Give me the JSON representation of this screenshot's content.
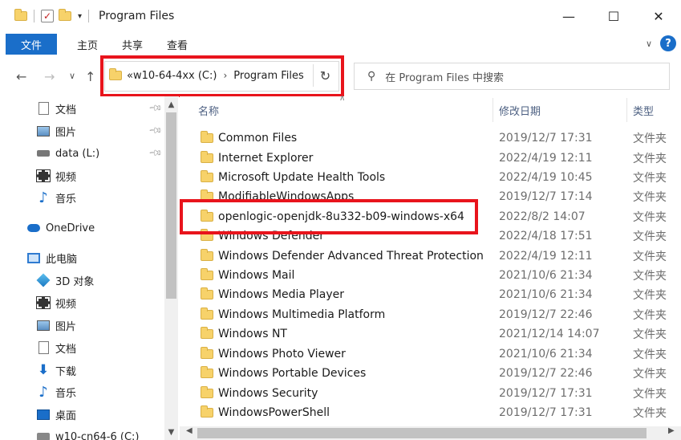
{
  "window": {
    "title": "Program Files",
    "controls": {
      "minimize": "—",
      "maximize": "☐",
      "close": "✕"
    }
  },
  "ribbon": {
    "file_tab": "文件",
    "tabs": [
      "主页",
      "共享",
      "查看"
    ],
    "help": "?"
  },
  "nav": {
    "back": "←",
    "forward": "→",
    "recent": "∨",
    "up": "↑",
    "address": {
      "prefix": "«",
      "segment1": "w10-64-4xx (C:)",
      "separator": "›",
      "segment2": "Program Files",
      "refresh": "↻"
    },
    "search_placeholder": "在 Program Files 中搜索"
  },
  "sidebar": {
    "items": [
      {
        "label": "文档",
        "icon": "document-icon",
        "pinned": true
      },
      {
        "label": "图片",
        "icon": "pictures-icon",
        "pinned": true
      },
      {
        "label": "data (L:)",
        "icon": "drive-icon",
        "pinned": true
      },
      {
        "label": "视频",
        "icon": "video-icon",
        "pinned": false
      },
      {
        "label": "音乐",
        "icon": "music-icon",
        "pinned": false
      },
      {
        "label": "OneDrive",
        "icon": "onedrive-icon",
        "pinned": false
      },
      {
        "label": "此电脑",
        "icon": "pc-icon",
        "pinned": false
      },
      {
        "label": "3D 对象",
        "icon": "3d-objects-icon",
        "pinned": false
      },
      {
        "label": "视频",
        "icon": "video-icon",
        "pinned": false
      },
      {
        "label": "图片",
        "icon": "pictures-icon",
        "pinned": false
      },
      {
        "label": "文档",
        "icon": "document-icon",
        "pinned": false
      },
      {
        "label": "下载",
        "icon": "download-icon",
        "pinned": false
      },
      {
        "label": "音乐",
        "icon": "music-icon",
        "pinned": false
      },
      {
        "label": "桌面",
        "icon": "desktop-icon",
        "pinned": false
      },
      {
        "label": "w10-cn64-6 (C:)",
        "icon": "drive-icon",
        "pinned": false
      }
    ]
  },
  "columns": {
    "name": "名称",
    "date": "修改日期",
    "type": "类型"
  },
  "files": [
    {
      "name": "Common Files",
      "date": "2019/12/7 17:31",
      "type": "文件夹"
    },
    {
      "name": "Internet Explorer",
      "date": "2022/4/19 12:11",
      "type": "文件夹"
    },
    {
      "name": "Microsoft Update Health Tools",
      "date": "2022/4/19 10:45",
      "type": "文件夹"
    },
    {
      "name": "ModifiableWindowsApps",
      "date": "2019/12/7 17:14",
      "type": "文件夹"
    },
    {
      "name": "openlogic-openjdk-8u332-b09-windows-x64",
      "date": "2022/8/2 14:07",
      "type": "文件夹"
    },
    {
      "name": "Windows Defender",
      "date": "2022/4/18 17:51",
      "type": "文件夹"
    },
    {
      "name": "Windows Defender Advanced Threat Protection",
      "date": "2022/4/19 12:11",
      "type": "文件夹"
    },
    {
      "name": "Windows Mail",
      "date": "2021/10/6 21:34",
      "type": "文件夹"
    },
    {
      "name": "Windows Media Player",
      "date": "2021/10/6 21:34",
      "type": "文件夹"
    },
    {
      "name": "Windows Multimedia Platform",
      "date": "2019/12/7 22:46",
      "type": "文件夹"
    },
    {
      "name": "Windows NT",
      "date": "2021/12/14 14:07",
      "type": "文件夹"
    },
    {
      "name": "Windows Photo Viewer",
      "date": "2021/10/6 21:34",
      "type": "文件夹"
    },
    {
      "name": "Windows Portable Devices",
      "date": "2019/12/7 22:46",
      "type": "文件夹"
    },
    {
      "name": "Windows Security",
      "date": "2019/12/7 17:31",
      "type": "文件夹"
    },
    {
      "name": "WindowsPowerShell",
      "date": "2019/12/7 17:31",
      "type": "文件夹"
    }
  ],
  "colors": {
    "accent": "#1a6ec9",
    "highlight": "#e8141c",
    "folder": "#f7d26a"
  }
}
